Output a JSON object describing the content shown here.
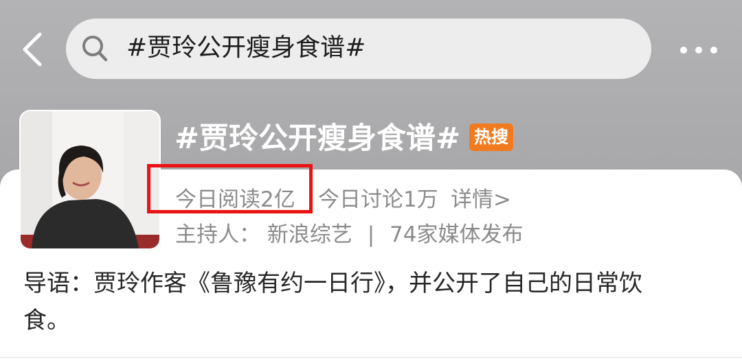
{
  "header": {
    "back_icon": "chevron-left-icon",
    "search_icon": "search-icon",
    "search_query": "#贾玲公开瘦身食谱#",
    "more_icon": "more-dots-icon"
  },
  "topic": {
    "title": "#贾玲公开瘦身食谱#",
    "badge": "热搜",
    "badge_color": "#f27b1f",
    "reads_today": "今日阅读2亿",
    "discussions_today": "今日讨论1万",
    "details_link": "详情>",
    "host_label": "主持人：",
    "host_name": "新浪综艺",
    "separator": "|",
    "media_count": "74家媒体发布"
  },
  "intro": {
    "text": "导语：贾玲作客《鲁豫有约一日行》，并公开了自己的日常饮食。"
  },
  "annotation": {
    "highlight_color": "#ea1212"
  }
}
